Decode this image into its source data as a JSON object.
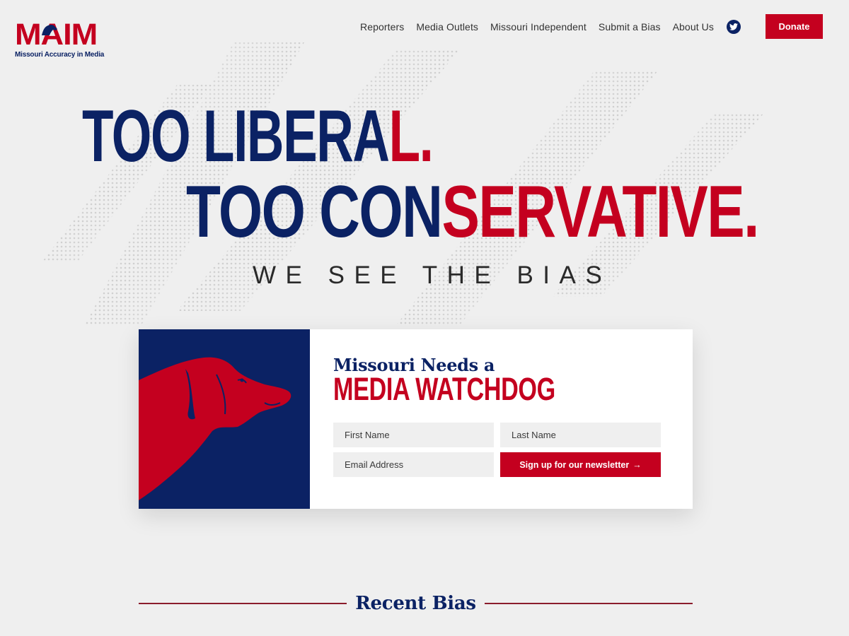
{
  "brand": {
    "logo_mark": "MAIM",
    "logo_subtitle": "Missouri Accuracy in Media"
  },
  "nav": {
    "items": [
      {
        "label": "Reporters"
      },
      {
        "label": "Media Outlets"
      },
      {
        "label": "Missouri Independent"
      },
      {
        "label": "Submit a Bias"
      },
      {
        "label": "About Us"
      }
    ],
    "social_icon": "twitter-icon",
    "donate_label": "Donate"
  },
  "hero": {
    "line1_navy": "TOO LIBERA",
    "line1_red": "L.",
    "line2_navy": "TOO CON",
    "line2_red": "SERVATIVE.",
    "tagline": "WE SEE THE BIAS"
  },
  "newsletter": {
    "kicker": "Missouri Needs a",
    "headline": "MEDIA WATCHDOG",
    "first_name_placeholder": "First Name",
    "last_name_placeholder": "Last Name",
    "email_placeholder": "Email Address",
    "submit_label": "Sign up for our newsletter",
    "submit_arrow": "→"
  },
  "recent": {
    "title": "Recent Bias"
  },
  "colors": {
    "navy": "#0b2264",
    "red": "#c4001f",
    "background": "#efefef"
  }
}
